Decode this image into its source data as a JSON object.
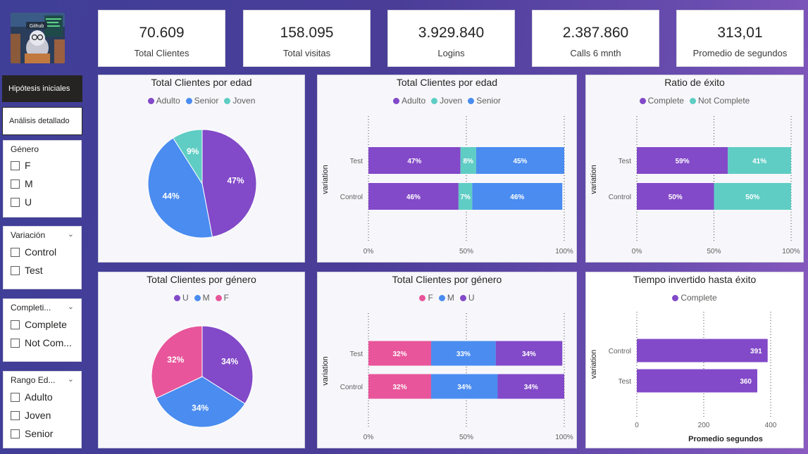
{
  "kpis": [
    {
      "value": "70.609",
      "label": "Total Clientes"
    },
    {
      "value": "158.095",
      "label": "Total visitas"
    },
    {
      "value": "3.929.840",
      "label": "Logins"
    },
    {
      "value": "2.387.860",
      "label": "Calls 6 mnth"
    },
    {
      "value": "313,01",
      "label": "Promedio de segundos"
    }
  ],
  "logo": {
    "text": "Github"
  },
  "nav": {
    "hipotesis": "Hipótesis iniciales",
    "analisis": "Análisis detallado"
  },
  "slicers": {
    "genero": {
      "title": "Género",
      "options": [
        "F",
        "M",
        "U"
      ]
    },
    "variacion": {
      "title": "Variación",
      "options": [
        "Control",
        "Test"
      ]
    },
    "completion": {
      "title": "Completi...",
      "options": [
        "Complete",
        "Not Com..."
      ]
    },
    "rango": {
      "title": "Rango Ed...",
      "options": [
        "Adulto",
        "Joven",
        "Senior"
      ]
    }
  },
  "colors": {
    "purple": "#8249c8",
    "blue": "#4a8cf0",
    "teal": "#5fcdc4",
    "pink": "#e8559a"
  },
  "panels": {
    "pie_edad": {
      "title": "Total Clientes por edad",
      "legend": [
        "Adulto",
        "Senior",
        "Joven"
      ]
    },
    "bar_edad": {
      "title": "Total Clientes por edad",
      "legend": [
        "Adulto",
        "Joven",
        "Senior"
      ],
      "ylabel": "variation"
    },
    "bar_exito": {
      "title": "Ratio de éxito",
      "legend": [
        "Complete",
        "Not Complete"
      ],
      "ylabel": "variation"
    },
    "pie_genero": {
      "title": "Total Clientes por género",
      "legend": [
        "U",
        "M",
        "F"
      ]
    },
    "bar_genero": {
      "title": "Total Clientes por género",
      "legend": [
        "F",
        "M",
        "U"
      ],
      "ylabel": "variation"
    },
    "bar_tiempo": {
      "title": "Tiempo invertido hasta éxito",
      "legend": [
        "Complete"
      ],
      "ylabel": "variation",
      "xlabel": "Promedio segundos"
    }
  },
  "chart_data": [
    {
      "id": "pie_edad",
      "type": "pie",
      "labels": [
        "Adulto",
        "Senior",
        "Joven"
      ],
      "values": [
        47,
        44,
        9
      ],
      "value_labels": [
        "47%",
        "44%",
        "9%"
      ],
      "colors": [
        "#8249c8",
        "#4a8cf0",
        "#5fcdc4"
      ]
    },
    {
      "id": "bar_edad",
      "type": "bar",
      "orientation": "horizontal",
      "stacked": "100%",
      "categories": [
        "Test",
        "Control"
      ],
      "series": [
        {
          "name": "Adulto",
          "values": [
            47,
            46
          ],
          "labels": [
            "47%",
            "46%"
          ],
          "color": "#8249c8"
        },
        {
          "name": "Joven",
          "values": [
            8,
            7
          ],
          "labels": [
            "8%",
            "7%"
          ],
          "color": "#5fcdc4"
        },
        {
          "name": "Senior",
          "values": [
            45,
            46
          ],
          "labels": [
            "45%",
            "46%"
          ],
          "color": "#4a8cf0"
        }
      ],
      "ylabel": "variation",
      "xticks": [
        "0%",
        "50%",
        "100%"
      ]
    },
    {
      "id": "bar_exito",
      "type": "bar",
      "orientation": "horizontal",
      "stacked": "100%",
      "categories": [
        "Test",
        "Control"
      ],
      "series": [
        {
          "name": "Complete",
          "values": [
            59,
            50
          ],
          "labels": [
            "59%",
            "50%"
          ],
          "color": "#8249c8"
        },
        {
          "name": "Not Complete",
          "values": [
            41,
            50
          ],
          "labels": [
            "41%",
            "50%"
          ],
          "color": "#5fcdc4"
        }
      ],
      "ylabel": "variation",
      "xticks": [
        "0%",
        "50%",
        "100%"
      ]
    },
    {
      "id": "pie_genero",
      "type": "pie",
      "labels": [
        "U",
        "M",
        "F"
      ],
      "values": [
        34,
        34,
        32
      ],
      "value_labels": [
        "34%",
        "34%",
        "32%"
      ],
      "colors": [
        "#8249c8",
        "#4a8cf0",
        "#e8559a"
      ]
    },
    {
      "id": "bar_genero",
      "type": "bar",
      "orientation": "horizontal",
      "stacked": "100%",
      "categories": [
        "Test",
        "Control"
      ],
      "series": [
        {
          "name": "F",
          "values": [
            32,
            32
          ],
          "labels": [
            "32%",
            "32%"
          ],
          "color": "#e8559a"
        },
        {
          "name": "M",
          "values": [
            33,
            34
          ],
          "labels": [
            "33%",
            "34%"
          ],
          "color": "#4a8cf0"
        },
        {
          "name": "U",
          "values": [
            34,
            34
          ],
          "labels": [
            "34%",
            "34%"
          ],
          "color": "#8249c8"
        }
      ],
      "ylabel": "variation",
      "xticks": [
        "0%",
        "50%",
        "100%"
      ]
    },
    {
      "id": "bar_tiempo",
      "type": "bar",
      "orientation": "horizontal",
      "categories": [
        "Control",
        "Test"
      ],
      "series": [
        {
          "name": "Complete",
          "values": [
            391,
            360
          ],
          "labels": [
            "391",
            "360"
          ],
          "color": "#8249c8"
        }
      ],
      "ylabel": "variation",
      "xlabel": "Promedio segundos",
      "xlim": [
        0,
        480
      ],
      "xticks": [
        "0",
        "200",
        "400"
      ],
      "xtick_values": [
        0,
        200,
        400
      ]
    }
  ]
}
